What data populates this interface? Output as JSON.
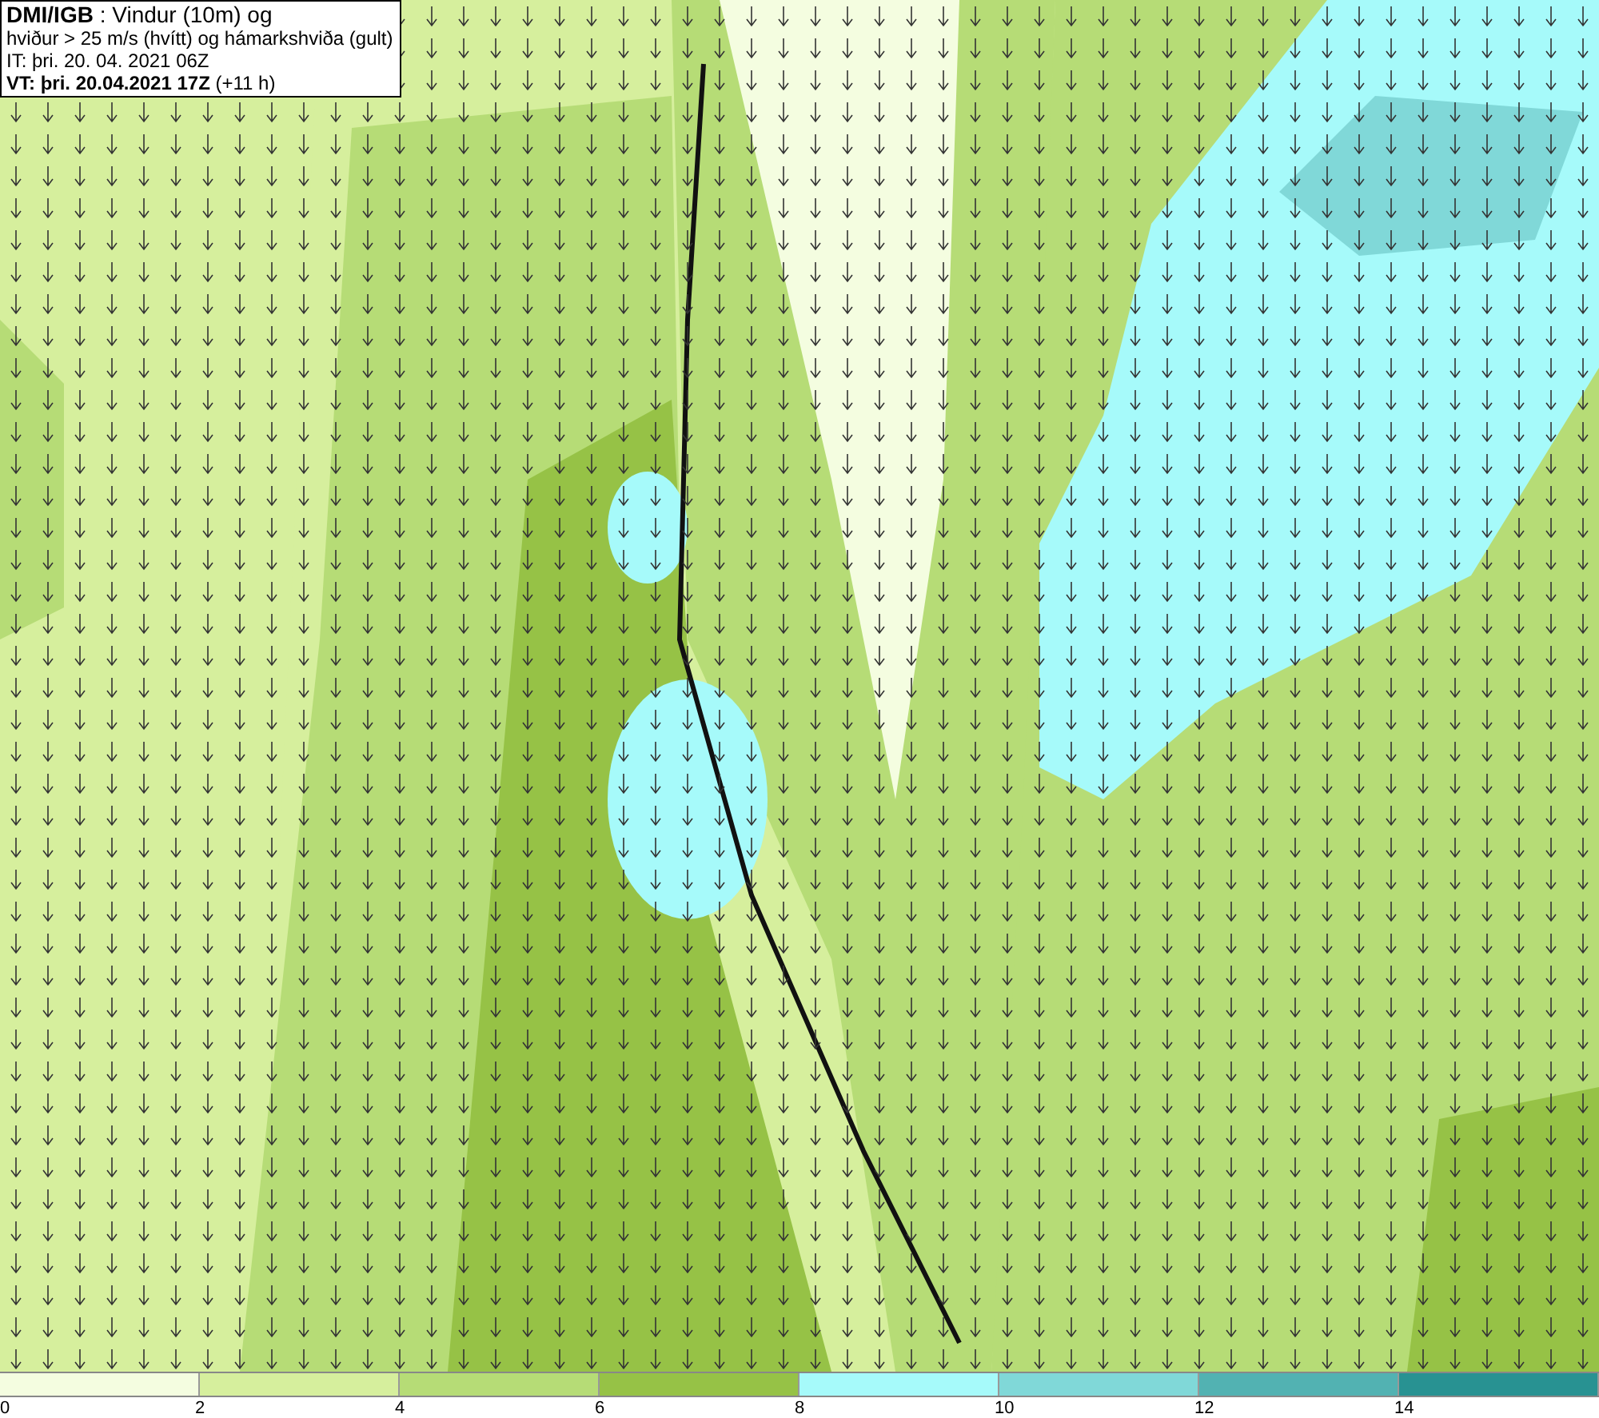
{
  "title_box": {
    "lines": [
      "**DMI/IGB** : Vindur (10m) og",
      "hviður > 25 m/s (hvítt) og hámarkshviða (gult)",
      "IT: þri. 20. 04. 2021 06Z",
      "**VT: þri. 20.04.2021 17Z** (+11 h)"
    ]
  },
  "legend": {
    "bins": [
      {
        "color": "#f4fde0",
        "label": "0"
      },
      {
        "color": "#d6ef9d",
        "label": "2"
      },
      {
        "color": "#b6dc76",
        "label": "4"
      },
      {
        "color": "#96c246",
        "label": "6"
      },
      {
        "color": "#a6fafa",
        "label": "8"
      },
      {
        "color": "#80d8d8",
        "label": "10"
      },
      {
        "color": "#52b2b2",
        "label": "12"
      },
      {
        "color": "#289292",
        "label": "14"
      }
    ]
  }
}
